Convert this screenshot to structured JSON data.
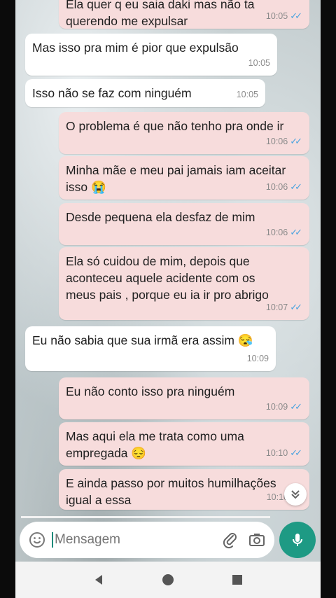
{
  "composer": {
    "placeholder": "Mensagem"
  },
  "messages": [
    {
      "id": "m0",
      "direction": "out",
      "text": "Ela quer q eu saia daki mas não ta\nquerendo me expulsar",
      "time": "10:05",
      "status": "read"
    },
    {
      "id": "m1",
      "direction": "in",
      "text": "Mas isso pra mim é pior que expulsão",
      "time": "10:05"
    },
    {
      "id": "m2",
      "direction": "in",
      "text": "Isso não se faz com ninguém",
      "time": "10:05"
    },
    {
      "id": "m3",
      "direction": "out",
      "text": "O problema é que não tenho pra onde ir",
      "time": "10:06",
      "status": "read"
    },
    {
      "id": "m4",
      "direction": "out",
      "text": "Minha mãe e meu pai jamais iam aceitar\nisso 😭",
      "time": "10:06",
      "status": "read"
    },
    {
      "id": "m5",
      "direction": "out",
      "text": "Desde pequena ela desfaz de mim",
      "time": "10:06",
      "status": "read"
    },
    {
      "id": "m6",
      "direction": "out",
      "text": "Ela só cuidou de mim, depois que\naconteceu aquele acidente com os\nmeus pais , porque eu ia ir pro abrigo",
      "time": "10:07",
      "status": "read"
    },
    {
      "id": "m7",
      "direction": "in",
      "text": "Eu não sabia que sua irmã era assim 😪",
      "time": "10:09"
    },
    {
      "id": "m8",
      "direction": "out",
      "text": "Eu não conto isso pra ninguém",
      "time": "10:09",
      "status": "read"
    },
    {
      "id": "m9",
      "direction": "out",
      "text": "Mas aqui ela me trata como uma\nempregada 😔",
      "time": "10:10",
      "status": "read"
    },
    {
      "id": "m10",
      "direction": "out",
      "text": "E ainda passo por muitos humilhações\nigual a essa",
      "time": "10:10",
      "status": "read"
    }
  ],
  "icons": {
    "emoji": "emoji-icon",
    "attach": "paperclip-icon",
    "camera": "camera-icon",
    "mic": "microphone-icon",
    "scroll": "chevron-double-down-icon",
    "nav_back": "back-triangle-icon",
    "nav_home": "home-circle-icon",
    "nav_recents": "recents-square-icon"
  },
  "colors": {
    "outgoing_bubble": "#f7dcdc",
    "incoming_bubble": "#ffffff",
    "read_tick": "#4aa3df",
    "accent": "#1e9a84"
  }
}
